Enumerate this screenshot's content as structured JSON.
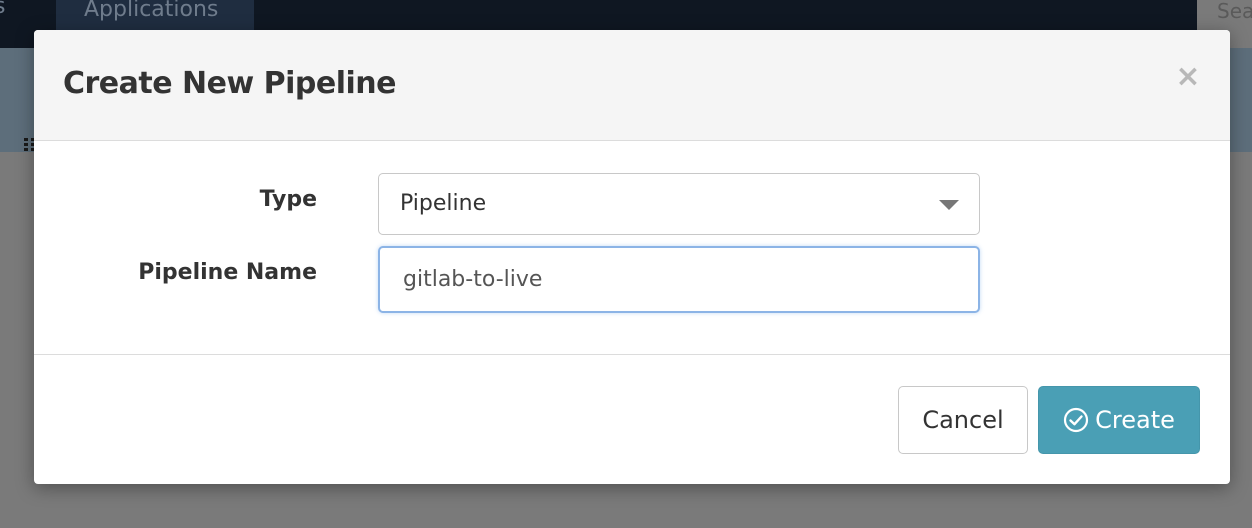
{
  "background": {
    "nav_fragment": "s",
    "nav_tab": "Applications",
    "search_fragment": "Sea"
  },
  "modal": {
    "title": "Create New Pipeline",
    "close_symbol": "×",
    "form": {
      "type_label": "Type",
      "type_value": "Pipeline",
      "name_label": "Pipeline Name",
      "name_value": "gitlab-to-live"
    },
    "footer": {
      "cancel_label": "Cancel",
      "create_label": "Create"
    }
  },
  "colors": {
    "primary_button": "#4a9fb5",
    "focus_border": "#8cb4e6",
    "topbar": "#0f1722"
  },
  "icons": [
    "grid-icon",
    "close-icon",
    "caret-down-icon",
    "check-circle-icon"
  ]
}
